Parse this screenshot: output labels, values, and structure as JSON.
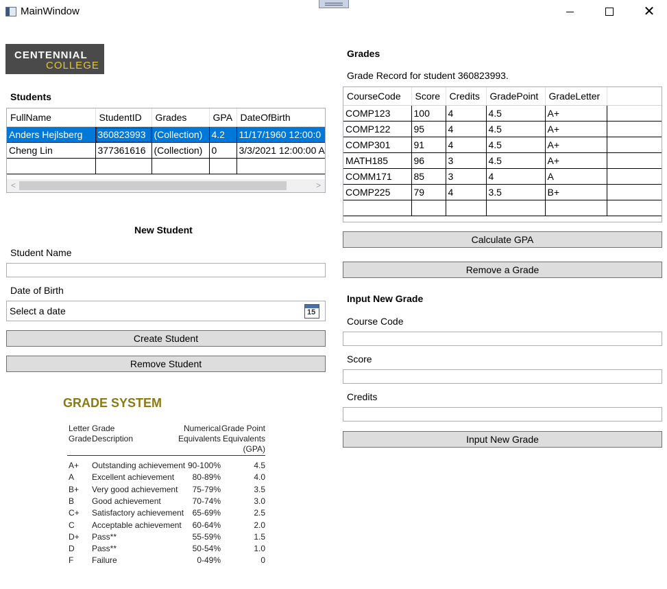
{
  "window": {
    "title": "MainWindow"
  },
  "logo": {
    "line1": "CENTENNIAL",
    "line2": "COLLEGE"
  },
  "students": {
    "heading": "Students",
    "columns": [
      "FullName",
      "StudentID",
      "Grades",
      "GPA",
      "DateOfBirth"
    ],
    "rows": [
      [
        "Anders Hejlsberg",
        "360823993",
        "(Collection)",
        "4.2",
        "11/17/1960 12:00:0"
      ],
      [
        "Cheng Lin",
        "377361616",
        "(Collection)",
        "0",
        "3/3/2021 12:00:00 A"
      ]
    ],
    "selected_row": 0
  },
  "new_student": {
    "heading": "New Student",
    "name_label": "Student Name",
    "name_value": "",
    "dob_label": "Date of Birth",
    "dob_placeholder": "Select a date",
    "calendar_day": "15",
    "create_button": "Create Student",
    "remove_button": "Remove Student"
  },
  "grades": {
    "heading": "Grades",
    "record_text": "Grade Record for student 360823993.",
    "columns": [
      "CourseCode",
      "Score",
      "Credits",
      "GradePoint",
      "GradeLetter"
    ],
    "rows": [
      [
        "COMP123",
        "100",
        "4",
        "4.5",
        "A+"
      ],
      [
        "COMP122",
        "95",
        "4",
        "4.5",
        "A+"
      ],
      [
        "COMP301",
        "91",
        "4",
        "4.5",
        "A+"
      ],
      [
        "MATH185",
        "96",
        "3",
        "4.5",
        "A+"
      ],
      [
        "COMM171",
        "85",
        "3",
        "4",
        "A"
      ],
      [
        "COMP225",
        "79",
        "4",
        "3.5",
        "B+"
      ]
    ],
    "calculate_button": "Calculate GPA",
    "remove_button": "Remove a Grade"
  },
  "new_grade": {
    "heading": "Input New Grade",
    "course_label": "Course Code",
    "score_label": "Score",
    "credits_label": "Credits",
    "input_button": "Input New Grade"
  },
  "grade_system": {
    "title": "GRADE SYSTEM",
    "headers": {
      "letter": [
        "Letter",
        "Grade"
      ],
      "description": [
        "Grade",
        "Description"
      ],
      "numerical": [
        "Numerical",
        "Equivalents"
      ],
      "gpa": [
        "Grade Point",
        "Equivalents",
        "(GPA)"
      ]
    },
    "rows": [
      [
        "A+",
        "Outstanding achievement",
        "90-100%",
        "4.5"
      ],
      [
        "A",
        "Excellent achievement",
        "80-89%",
        "4.0"
      ],
      [
        "B+",
        "Very good achievement",
        "75-79%",
        "3.5"
      ],
      [
        "B",
        "Good achievement",
        "70-74%",
        "3.0"
      ],
      [
        "C+",
        "Satisfactory achievement",
        "65-69%",
        "2.5"
      ],
      [
        "C",
        "Acceptable achievement",
        "60-64%",
        "2.0"
      ],
      [
        "D+",
        "Pass**",
        "55-59%",
        "1.5"
      ],
      [
        "D",
        "Pass**",
        "50-54%",
        "1.0"
      ],
      [
        "F",
        "Failure",
        "0-49%",
        "0"
      ]
    ]
  }
}
